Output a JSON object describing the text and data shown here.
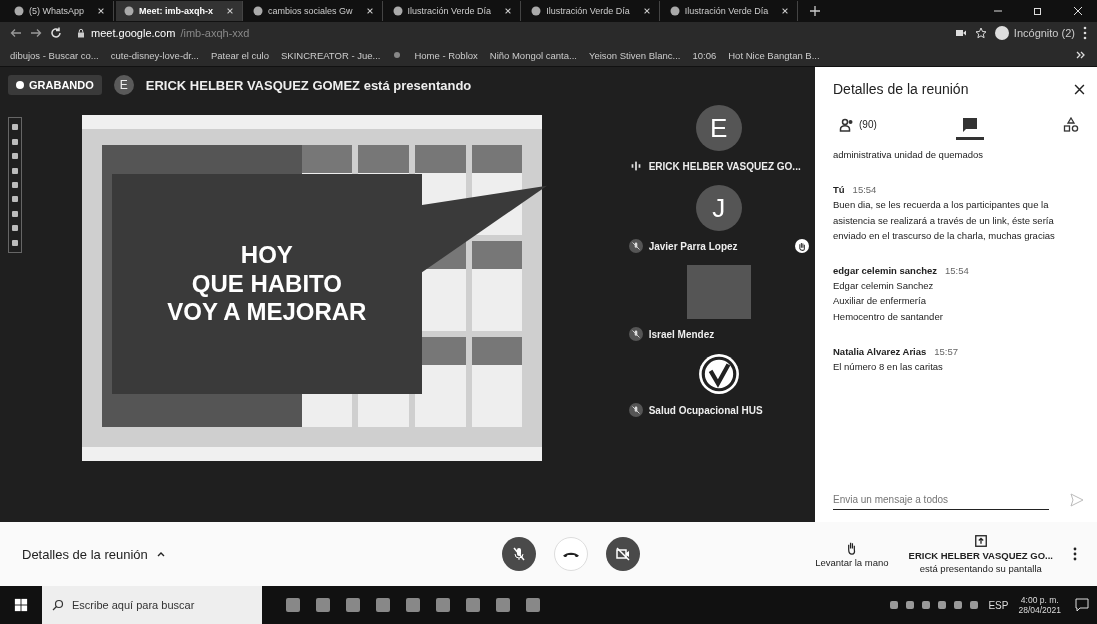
{
  "browser": {
    "tabs": [
      {
        "title": "(5) WhatsApp",
        "selected": false
      },
      {
        "title": "Meet: imb-axqh-x",
        "selected": true
      },
      {
        "title": "cambios sociales Gw",
        "selected": false
      },
      {
        "title": "Ilustración Verde Día",
        "selected": false
      },
      {
        "title": "Ilustración Verde Día",
        "selected": false
      },
      {
        "title": "Ilustración Verde Día",
        "selected": false
      }
    ],
    "address_host": "meet.google.com",
    "address_path": "/imb-axqh-xxd",
    "profile": "Incógnito (2)",
    "bookmarks": [
      "dibujos - Buscar co...",
      "cute-disney-love-dr...",
      "Patear el culo",
      "SKINCREATOR - Jue...",
      "Home - Roblox",
      "Niño Mongol canta...",
      "Yeison Stiven Blanc...",
      "10:06",
      "Hot Nice Bangtan B..."
    ]
  },
  "meeting": {
    "recording_label": "GRABANDO",
    "presenter_initial": "E",
    "presenter_title": "ERICK HELBER VASQUEZ GOMEZ está presentando",
    "slide": {
      "lines": [
        "HOY",
        "QUE HABITO",
        "VOY A MEJORAR"
      ]
    },
    "participants": [
      {
        "kind": "avatar",
        "initial": "E",
        "name": "ERICK HELBER VASQUEZ GO...",
        "muted": false,
        "hand_raised": false
      },
      {
        "kind": "avatar",
        "initial": "J",
        "name": "Javier Parra Lopez",
        "muted": true,
        "hand_raised": true
      },
      {
        "kind": "video",
        "name": "Israel Mendez",
        "muted": true,
        "hand_raised": false
      },
      {
        "kind": "logo",
        "name": "Salud Ocupacional HUS",
        "muted": true,
        "hand_raised": false
      }
    ]
  },
  "panel": {
    "title": "Detalles de la reunión",
    "tabs": [
      {
        "kind": "people",
        "count": "(90)",
        "selected": false
      },
      {
        "kind": "chat",
        "selected": true
      },
      {
        "kind": "activities",
        "selected": false
      }
    ],
    "messages": [
      {
        "lines": [
          "administrativa unidad de quemados"
        ]
      },
      {
        "sender": "Tú",
        "time": "15:54",
        "lines": [
          "Buen dia, se les recuerda a los participantes que la asistencia se realizará a través de un link, éste sería enviado en el trascurso de la charla, muchas gracias"
        ]
      },
      {
        "sender": "edgar celemin sanchez",
        "time": "15:54",
        "lines": [
          "Edgar celemin Sanchez",
          "Auxiliar de enfermería",
          "Hemocentro de santander"
        ]
      },
      {
        "sender": "Natalia Alvarez Arias",
        "time": "15:57",
        "lines": [
          "El número 8 en las caritas"
        ]
      }
    ],
    "input_placeholder": "Envia un mensaje a todos"
  },
  "bottom_bar": {
    "details_label": "Detalles de la reunión",
    "controls": [
      {
        "kind": "mic",
        "on": false
      },
      {
        "kind": "hangup",
        "on": true
      },
      {
        "kind": "camera",
        "on": false
      }
    ],
    "raise_hand_label": "Levantar la mano",
    "presenting_name": "ERICK HELBER VASQUEZ GO...",
    "presenting_text": "está presentando su pantalla"
  },
  "taskbar": {
    "search_placeholder": "Escribe aquí para buscar",
    "language": "ESP",
    "time": "4:00 p. m.",
    "date": "28/04/2021"
  }
}
